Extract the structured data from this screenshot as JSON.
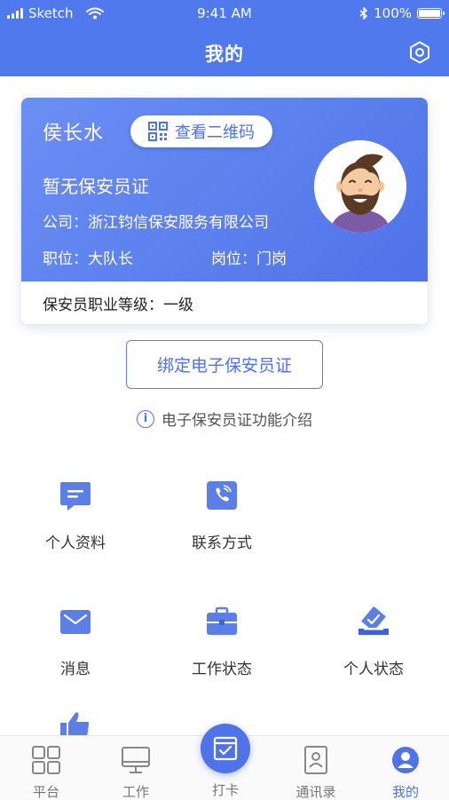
{
  "status_bar": {
    "carrier": "Sketch",
    "time": "9:41 AM",
    "battery_pct": "100%",
    "battery_level": 1.0,
    "icons": [
      "signal-icon",
      "wifi-icon",
      "bluetooth-icon",
      "battery-icon"
    ]
  },
  "header": {
    "title": "我的",
    "settings_icon": "gear-icon"
  },
  "profile_card": {
    "name": "侯长水",
    "qr_button_label": "查看二维码",
    "license_status": "暂无保安员证",
    "company": "公司：浙江钧信保安服务有限公司",
    "position": "职位：大队长",
    "post": "岗位：门岗",
    "level": "保安员职业等级：一级",
    "avatar_icon": "avatar-bearded-man"
  },
  "bind_button_label": "绑定电子保安员证",
  "intro_link": "电子保安员证功能介绍",
  "menu": [
    {
      "label": "个人资料",
      "icon": "message-doc-icon"
    },
    {
      "label": "联系方式",
      "icon": "phone-icon"
    },
    {
      "label": "消息",
      "icon": "envelope-icon"
    },
    {
      "label": "工作状态",
      "icon": "briefcase-icon"
    },
    {
      "label": "个人状态",
      "icon": "ballot-check-icon"
    }
  ],
  "tabs": [
    {
      "label": "平台",
      "icon": "grid-icon"
    },
    {
      "label": "工作",
      "icon": "monitor-icon"
    },
    {
      "label": "打卡",
      "icon": "calendar-check-icon"
    },
    {
      "label": "通讯录",
      "icon": "contacts-icon"
    },
    {
      "label": "我的",
      "icon": "profile-icon"
    }
  ],
  "colors": {
    "primary": "#4f79ec",
    "card_gradient_start": "#6b8ff3",
    "card_gradient_end": "#4f73e8",
    "icon_blue": "#5b7fe6"
  }
}
